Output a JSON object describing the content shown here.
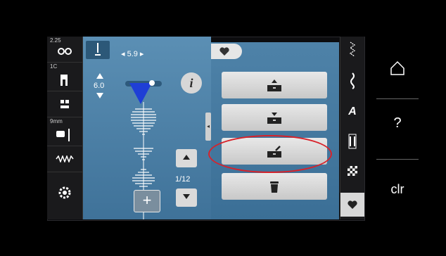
{
  "left_column": {
    "items": [
      {
        "label": "2.25",
        "icon": "tension-icon"
      },
      {
        "label": "1C",
        "icon": "presser-foot-icon"
      },
      {
        "label": "",
        "icon": "feed-dog-icon"
      },
      {
        "label": "9mm",
        "icon": "needle-plate-icon"
      },
      {
        "label": "",
        "icon": "stitch-balance-icon"
      },
      {
        "label": "",
        "icon": "bobbin-icon"
      }
    ]
  },
  "stitch_settings": {
    "width_value": "◂ 5.9 ▸",
    "length_value": "6.0",
    "info_label": "i",
    "page_indicator": "1/12",
    "add_label": "+"
  },
  "menu": {
    "favorites_tab_icon": "heart-icon",
    "buttons": [
      {
        "name": "load-from-memory",
        "icon": "drawer-arrow-out-icon"
      },
      {
        "name": "save-to-memory",
        "icon": "drawer-arrow-in-icon"
      },
      {
        "name": "overwrite-memory",
        "icon": "drawer-edit-icon"
      },
      {
        "name": "delete",
        "icon": "trash-icon"
      }
    ]
  },
  "categories": [
    {
      "name": "practical-stitches",
      "icon": "zigzag-icon"
    },
    {
      "name": "decorative-stitches",
      "icon": "wavy-icon"
    },
    {
      "name": "alphabets",
      "label": "A"
    },
    {
      "name": "buttonholes",
      "icon": "buttonhole-icon"
    },
    {
      "name": "quilt-stitches",
      "icon": "checker-icon"
    },
    {
      "name": "personal-memory",
      "icon": "heart-icon",
      "active": true
    }
  ],
  "hardware": {
    "home_icon": "home-icon",
    "help_label": "?",
    "clear_label": "clr"
  },
  "colors": {
    "panel_blue": "#4a7fa6",
    "highlight_red": "#d8222a",
    "needle_blue": "#1f3fd6"
  }
}
